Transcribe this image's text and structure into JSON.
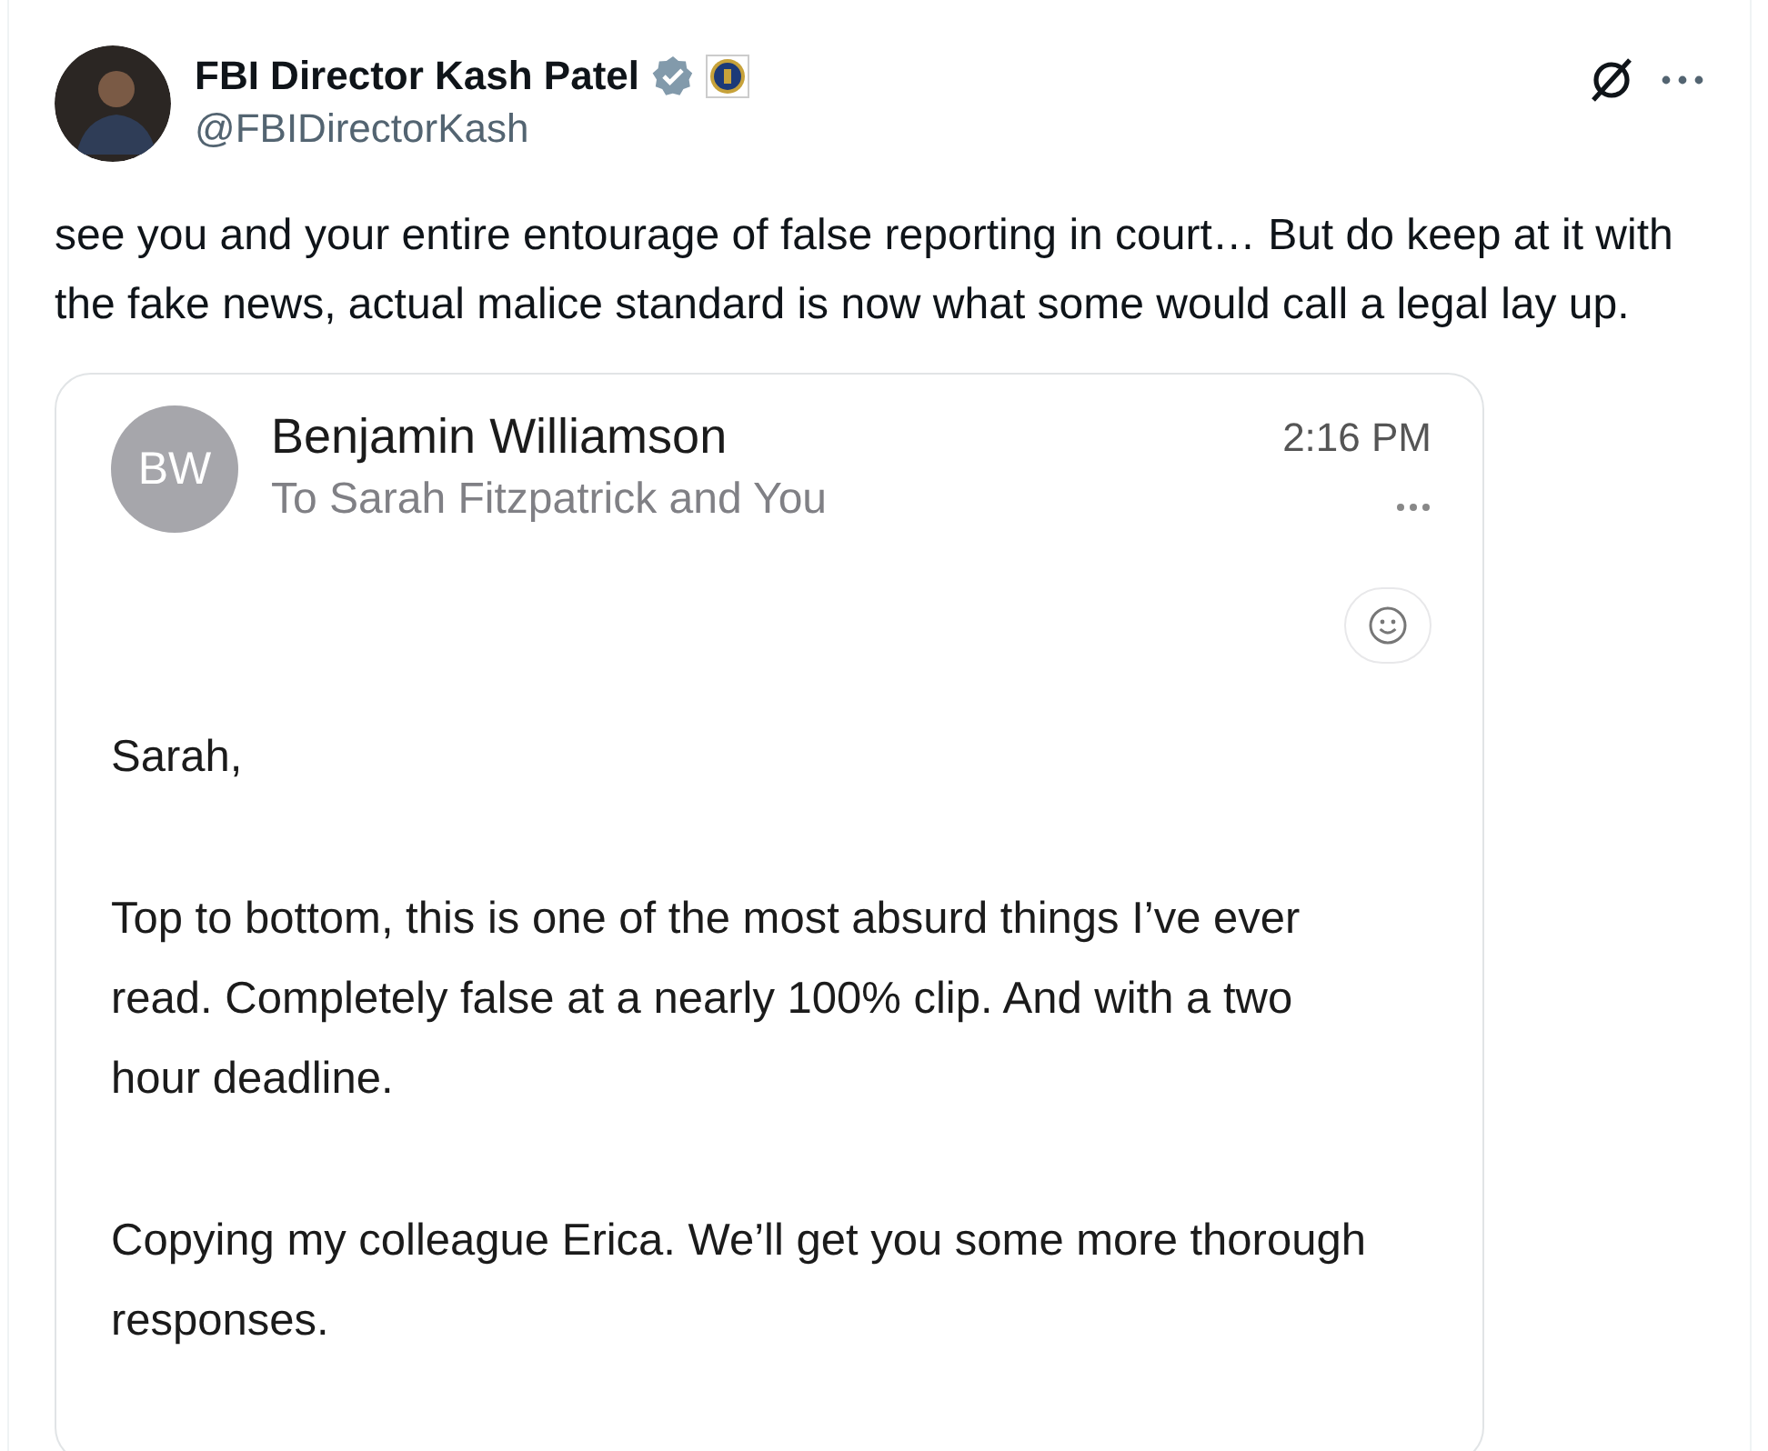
{
  "post": {
    "author": {
      "name": "FBI Director Kash Patel",
      "handle": "@FBIDirectorKash"
    },
    "text": "see you and your entire entourage of false reporting in court… But do keep at it with the fake news, actual malice standard is now what some would call a legal lay up.",
    "attachment": {
      "kind": "picture",
      "email": {
        "avatar_initials": "BW",
        "sender": "Benjamin Williamson",
        "recipients": "To Sarah Fitzpatrick and You",
        "time": "2:16 PM",
        "paragraphs": [
          "Sarah,",
          "Top to bottom, this is one of the most absurd things I’ve ever read. Completely false at a nearly 100% clip. And with a two hour deadline.",
          "Copying my colleague Erica. We’ll get you some more thorough responses."
        ]
      }
    }
  }
}
